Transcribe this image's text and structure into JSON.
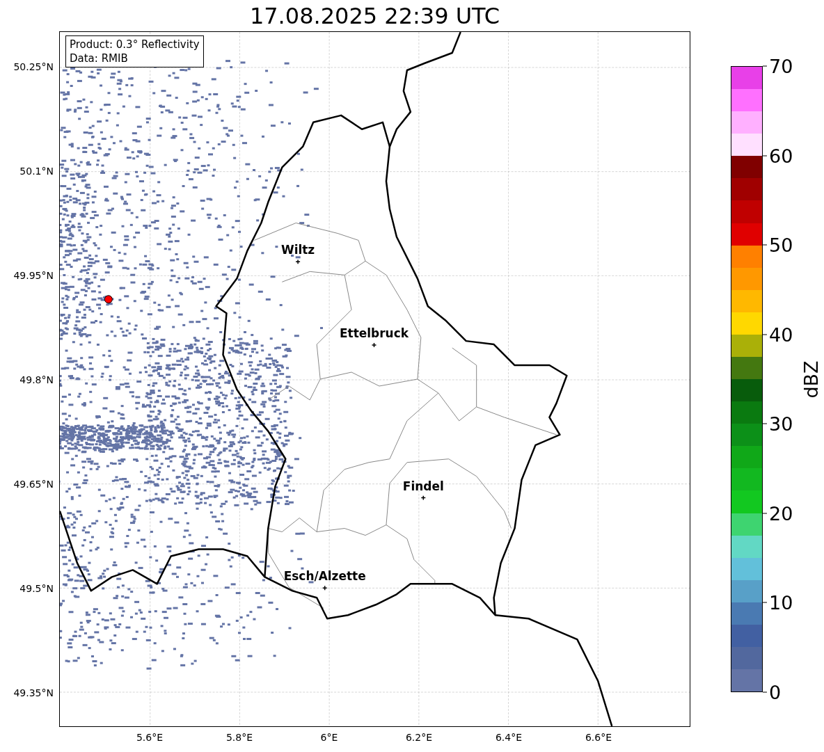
{
  "title": "17.08.2025 22:39 UTC",
  "info_box": {
    "lines": [
      "Product: 0.3° Reflectivity",
      "Data: RMIB"
    ]
  },
  "map": {
    "lat_ticks": [
      "50.25°N",
      "50.1°N",
      "49.95°N",
      "49.8°N",
      "49.65°N",
      "49.5°N",
      "49.35°N"
    ],
    "lon_ticks": [
      "5.6°E",
      "5.8°E",
      "6°E",
      "6.2°E",
      "6.4°E",
      "6.6°E"
    ],
    "cities": [
      {
        "name": "Wiltz"
      },
      {
        "name": "Ettelbruck"
      },
      {
        "name": "Findel"
      },
      {
        "name": "Esch/Alzette"
      }
    ]
  },
  "colorbar": {
    "label": "dBZ",
    "ticks": [
      "70",
      "60",
      "50",
      "40",
      "30",
      "20",
      "10",
      "0"
    ],
    "bins": [
      {
        "color": "#e840e8"
      },
      {
        "color": "#ff70ff"
      },
      {
        "color": "#ffb0ff"
      },
      {
        "color": "#ffe0ff"
      },
      {
        "color": "#800000"
      },
      {
        "color": "#a00000"
      },
      {
        "color": "#c00000"
      },
      {
        "color": "#e00000"
      },
      {
        "color": "#ff8000"
      },
      {
        "color": "#ff9800"
      },
      {
        "color": "#ffb800"
      },
      {
        "color": "#ffd800"
      },
      {
        "color": "#aab008"
      },
      {
        "color": "#447810"
      },
      {
        "color": "#085c0c"
      },
      {
        "color": "#0a7a10"
      },
      {
        "color": "#0c9018"
      },
      {
        "color": "#10a818"
      },
      {
        "color": "#12b820"
      },
      {
        "color": "#12c820"
      },
      {
        "color": "#3ed470"
      },
      {
        "color": "#62d8c4"
      },
      {
        "color": "#62c0da"
      },
      {
        "color": "#58a0c8"
      },
      {
        "color": "#4a7ab2"
      },
      {
        "color": "#4260a2"
      },
      {
        "color": "#52689e"
      },
      {
        "color": "#6474a6"
      }
    ]
  }
}
